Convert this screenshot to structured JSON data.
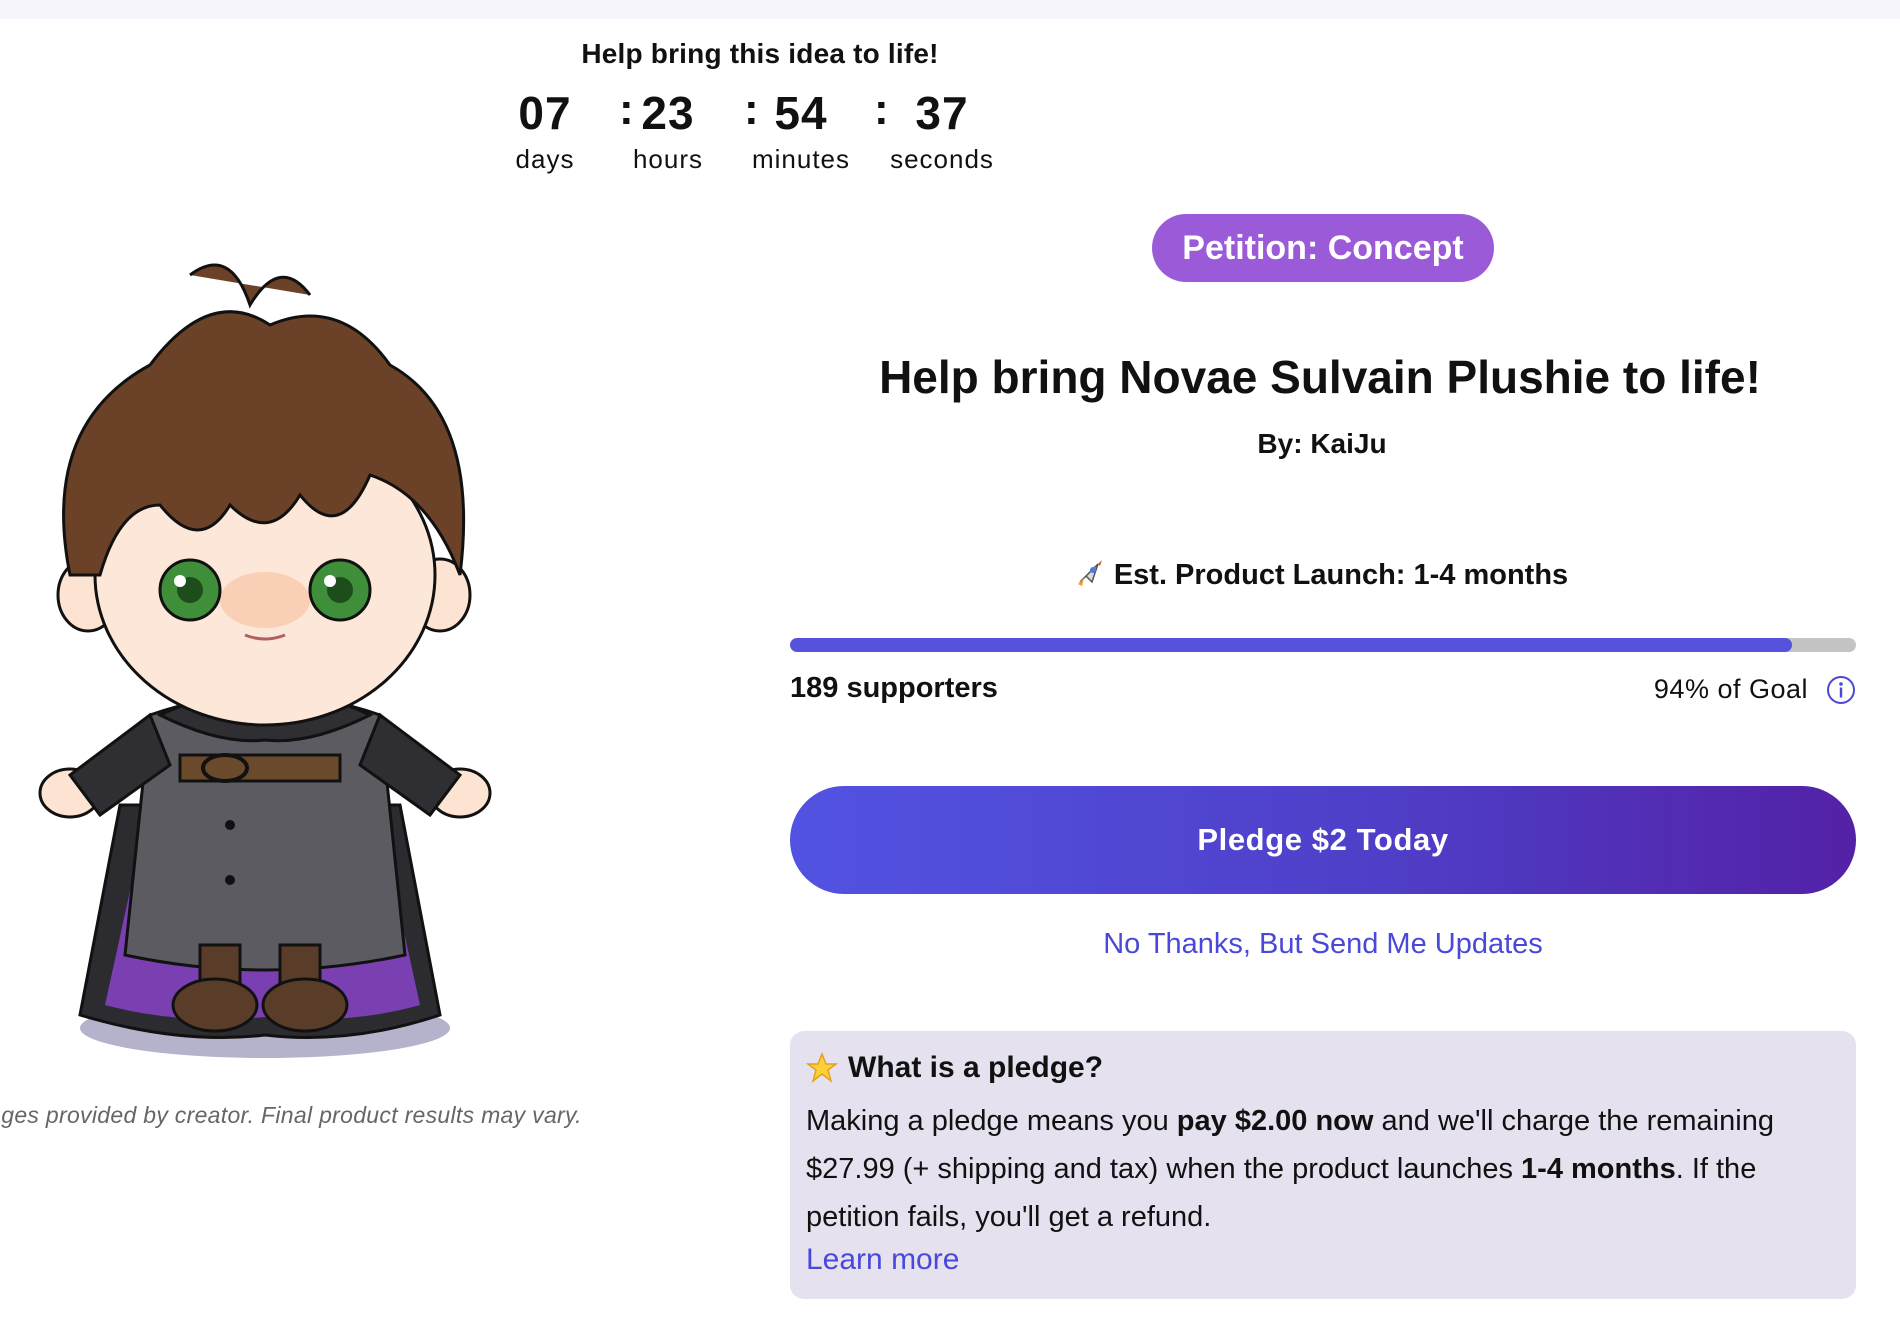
{
  "countdown": {
    "heading": "Help bring this idea to life!",
    "days": {
      "value": "07",
      "label": "days"
    },
    "hours": {
      "value": "23",
      "label": "hours"
    },
    "minutes": {
      "value": "54",
      "label": "minutes"
    },
    "seconds": {
      "value": "37",
      "label": "seconds"
    },
    "separator": ":"
  },
  "image": {
    "caption": "Images provided by creator. Final product results may vary."
  },
  "petition": {
    "badge": "Petition: Concept",
    "title": "Help bring Novae Sulvain Plushie to life!",
    "creator": "By: KaiJu",
    "launch": "Est. Product Launch: 1-4 months",
    "supporters": "189 supporters",
    "goal_text": "94% of Goal",
    "progress_percent": 94
  },
  "actions": {
    "pledge_label": "Pledge $2 Today",
    "updates_label": "No Thanks, But Send Me Updates"
  },
  "pledge_info": {
    "title": "What is a pledge?",
    "body_1": "Making a pledge means you ",
    "body_bold_1": "pay $2.00 now",
    "body_2": " and we'll charge the remaining $27.99 (+ shipping and tax) when the product launches ",
    "body_bold_2": "1-4 months",
    "body_3": ". If the petition fails, you'll get a refund.",
    "learn_more": "Learn more"
  },
  "colors": {
    "badge": "#9b5bd8",
    "progress_fill": "#5552dc",
    "progress_track": "#c4c4c4",
    "button_start": "#5253e2",
    "button_end": "#5321a6",
    "link": "#4a48d8",
    "info_box": "#e5e1ef"
  },
  "icons": [
    "rocket-icon",
    "info-icon",
    "star-icon"
  ]
}
